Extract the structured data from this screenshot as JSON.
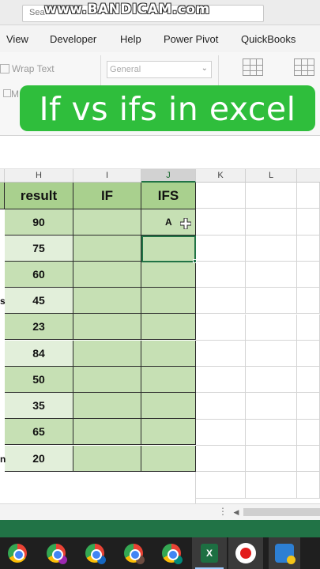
{
  "search": {
    "placeholder": "Sea"
  },
  "watermark": "www.BANDICAM.com",
  "ribbon_tabs": [
    "View",
    "Developer",
    "Help",
    "Power Pivot",
    "QuickBooks"
  ],
  "ribbon": {
    "wrap_text": "Wrap Text",
    "merge_partial": "M",
    "number_format": "General"
  },
  "overlay_title": "If vs ifs in excel",
  "columns": [
    "H",
    "I",
    "J",
    "K",
    "L"
  ],
  "selected_column": "J",
  "table": {
    "headers": {
      "result": "result",
      "if": "IF",
      "ifs": "IFS"
    },
    "rows": [
      {
        "result": "90",
        "if": "",
        "ifs": "A"
      },
      {
        "result": "75",
        "if": "",
        "ifs": ""
      },
      {
        "result": "60",
        "if": "",
        "ifs": ""
      },
      {
        "result": "45",
        "if": "",
        "ifs": ""
      },
      {
        "result": "23",
        "if": "",
        "ifs": ""
      },
      {
        "result": "84",
        "if": "",
        "ifs": ""
      },
      {
        "result": "50",
        "if": "",
        "ifs": ""
      },
      {
        "result": "35",
        "if": "",
        "ifs": ""
      },
      {
        "result": "65",
        "if": "",
        "ifs": ""
      },
      {
        "result": "20",
        "if": "",
        "ifs": ""
      }
    ],
    "left_edge_fragments": {
      "row4": "s",
      "row10": "n"
    }
  },
  "colors": {
    "excel_green": "#217346",
    "banner_green": "#2fbe3c",
    "header_fill": "#a9d08e",
    "cell_fill": "#c6e0b4",
    "alt_fill": "#e2efda"
  },
  "taskbar_icons": [
    "chrome-icon",
    "chrome-profile-icon",
    "chrome-profile-icon",
    "chrome-profile-icon",
    "chrome-profile-icon",
    "excel-icon",
    "bandicam-record-icon",
    "app-icon"
  ]
}
